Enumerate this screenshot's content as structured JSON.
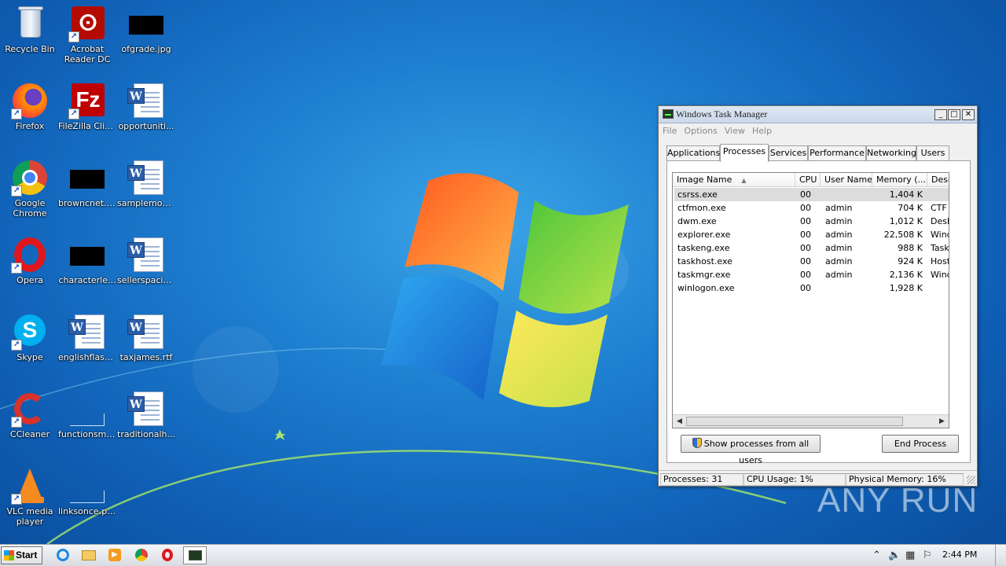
{
  "desktop": {
    "icons": [
      {
        "label": "Recycle Bin",
        "icon": "recycle-bin-icon"
      },
      {
        "label": "Acrobat Reader DC",
        "line1": "Acrobat",
        "line2": "Reader DC",
        "icon": "acrobat-reader-icon"
      },
      {
        "label": "ofgrade.jpg",
        "icon": "image-file-icon"
      },
      {
        "label": "Firefox",
        "icon": "firefox-icon"
      },
      {
        "label": "FileZilla Client",
        "icon": "filezilla-icon"
      },
      {
        "label": "opportuniti...",
        "icon": "word-document-icon"
      },
      {
        "label": "Google Chrome",
        "line1": "Google",
        "line2": "Chrome",
        "icon": "chrome-icon"
      },
      {
        "label": "browncnet.jpg",
        "icon": "image-file-icon"
      },
      {
        "label": "samplemove...",
        "icon": "word-document-icon"
      },
      {
        "label": "Opera",
        "icon": "opera-icon"
      },
      {
        "label": "characterle...",
        "icon": "image-file-icon"
      },
      {
        "label": "sellerspacifi...",
        "icon": "word-document-icon"
      },
      {
        "label": "Skype",
        "icon": "skype-icon"
      },
      {
        "label": "englishflash...",
        "icon": "word-document-icon"
      },
      {
        "label": "taxjames.rtf",
        "icon": "word-document-icon"
      },
      {
        "label": "CCleaner",
        "icon": "ccleaner-icon"
      },
      {
        "label": "functionsmi...",
        "icon": "image-file-icon"
      },
      {
        "label": "traditionalh...",
        "icon": "word-document-icon"
      },
      {
        "label": "VLC media player",
        "line1": "VLC media",
        "line2": "player",
        "icon": "vlc-icon"
      },
      {
        "label": "linksonce.png",
        "icon": "image-file-icon"
      }
    ]
  },
  "task_manager": {
    "title": "Windows Task Manager",
    "menu": [
      "File",
      "Options",
      "View",
      "Help"
    ],
    "tabs": [
      "Applications",
      "Processes",
      "Services",
      "Performance",
      "Networking",
      "Users"
    ],
    "active_tab": "Processes",
    "columns": [
      "Image Name",
      "CPU",
      "User Name",
      "Memory (...",
      "Desc"
    ],
    "processes": [
      {
        "name": "csrss.exe",
        "cpu": "00",
        "user": "",
        "memory": "1,404 K",
        "desc": ""
      },
      {
        "name": "ctfmon.exe",
        "cpu": "00",
        "user": "admin",
        "memory": "704 K",
        "desc": "CTF L"
      },
      {
        "name": "dwm.exe",
        "cpu": "00",
        "user": "admin",
        "memory": "1,012 K",
        "desc": "Desk"
      },
      {
        "name": "explorer.exe",
        "cpu": "00",
        "user": "admin",
        "memory": "22,508 K",
        "desc": "Wind"
      },
      {
        "name": "taskeng.exe",
        "cpu": "00",
        "user": "admin",
        "memory": "988 K",
        "desc": "Task"
      },
      {
        "name": "taskhost.exe",
        "cpu": "00",
        "user": "admin",
        "memory": "924 K",
        "desc": "Host"
      },
      {
        "name": "taskmgr.exe",
        "cpu": "00",
        "user": "admin",
        "memory": "2,136 K",
        "desc": "Wind"
      },
      {
        "name": "winlogon.exe",
        "cpu": "00",
        "user": "",
        "memory": "1,928 K",
        "desc": ""
      }
    ],
    "selected_process": "csrss.exe",
    "show_all_label": "Show processes from all users",
    "end_process_label": "End Process",
    "status": {
      "processes": "Processes: 31",
      "cpu": "CPU Usage: 1%",
      "memory": "Physical Memory: 16%"
    }
  },
  "watermark": "ANY RUN",
  "taskbar": {
    "start_label": "Start",
    "pinned": [
      "internet-explorer-icon",
      "explorer-folder-icon",
      "media-player-icon",
      "chrome-icon",
      "opera-icon",
      "task-manager-icon"
    ],
    "clock": "2:44 PM"
  },
  "colors": {
    "desktop_bg": "#1e7fd0",
    "selected_row": "#dcdcdc",
    "taskbar_bg": "#e4e7eb"
  }
}
